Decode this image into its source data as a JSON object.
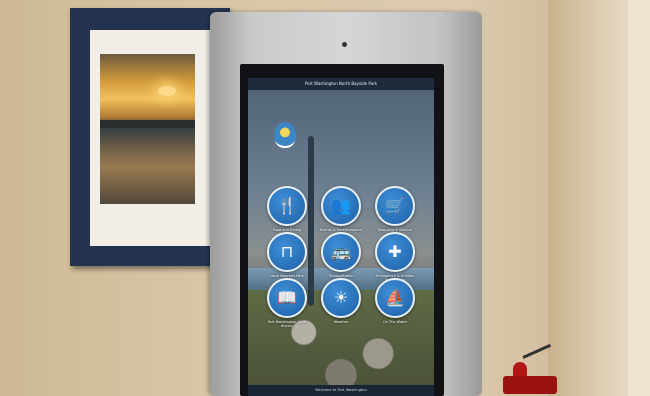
{
  "screen": {
    "header": "Port Washington North Bayside Park",
    "footer": "Welcome to Port Washington"
  },
  "tiles": [
    {
      "icon": "fork-knife-icon",
      "glyph": "🍴",
      "label": "Food and Dining"
    },
    {
      "icon": "people-icon",
      "glyph": "👥",
      "label": "Events & Entertainment"
    },
    {
      "icon": "shopping-cart-icon",
      "glyph": "🛒",
      "label": "Shopping & Service"
    },
    {
      "icon": "picnic-table-icon",
      "glyph": "⊓",
      "label": "Local Beaches Park"
    },
    {
      "icon": "bus-icon",
      "glyph": "🚌",
      "label": "Transportation"
    },
    {
      "icon": "medical-cross-icon",
      "glyph": "✚",
      "label": "Emergency & Utilities Safety Help"
    },
    {
      "icon": "book-icon",
      "glyph": "📖",
      "label": "Port Washington Local History"
    },
    {
      "icon": "sun-icon",
      "glyph": "☀",
      "label": "Weather"
    },
    {
      "icon": "boat-icon",
      "glyph": "⛵",
      "label": "On The Water"
    }
  ]
}
